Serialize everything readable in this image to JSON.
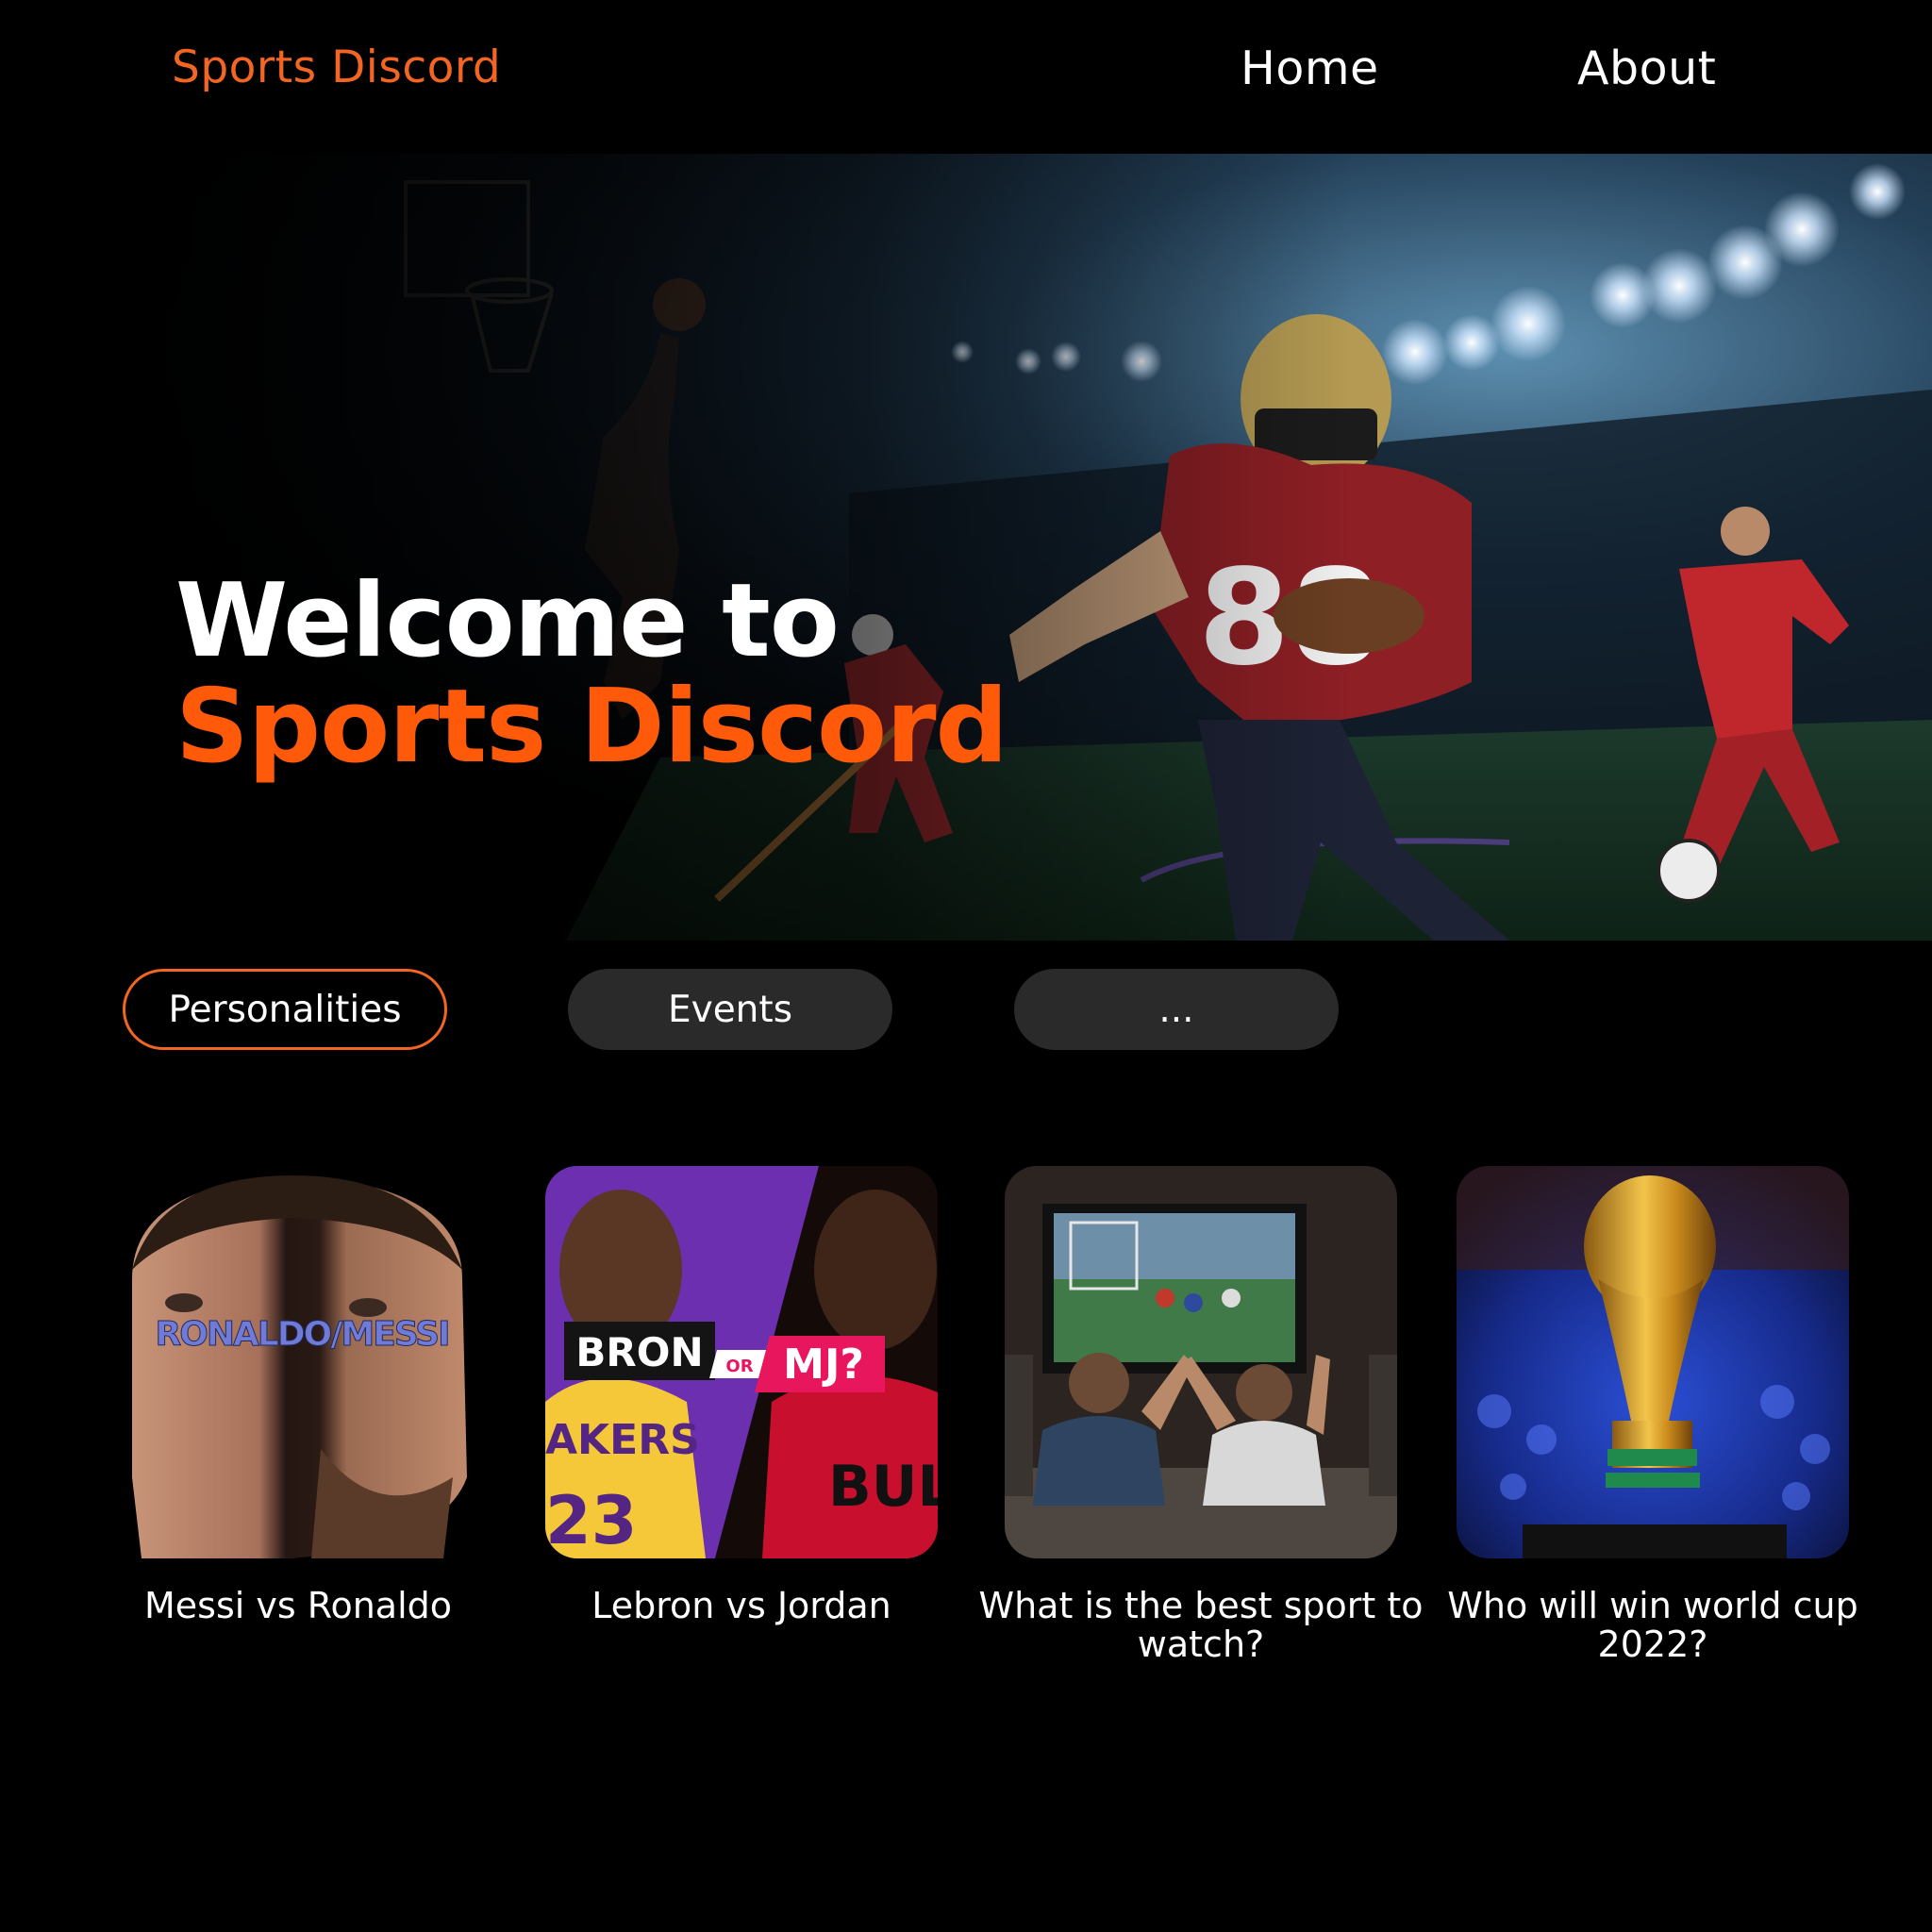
{
  "header": {
    "brand": "Sports Discord",
    "nav": [
      {
        "label": "Home"
      },
      {
        "label": "About"
      }
    ]
  },
  "hero": {
    "title_line1": "Welcome to",
    "title_line2": "Sports Discord",
    "image_text": {
      "jersey_number": "88"
    }
  },
  "tabs": [
    {
      "label": "Personalities",
      "active": true
    },
    {
      "label": "Events",
      "active": false
    },
    {
      "label": "...",
      "active": false
    }
  ],
  "cards": [
    {
      "caption": "Messi vs Ronaldo",
      "overlay": "RONALDO/MESSI"
    },
    {
      "caption": "Lebron vs Jordan",
      "overlay_left": "BRON",
      "overlay_mid": "OR",
      "overlay_right": "MJ?",
      "jersey_left": "AKERS",
      "jersey_left_num": "23",
      "jersey_right": "BULL"
    },
    {
      "caption": "What is the best sport to watch?"
    },
    {
      "caption": "Who will win world cup 2022?"
    }
  ],
  "colors": {
    "accent": "#f26522",
    "hero_accent": "#ff5a0a",
    "background": "#000000",
    "tab_bg": "#2a2a2a"
  }
}
